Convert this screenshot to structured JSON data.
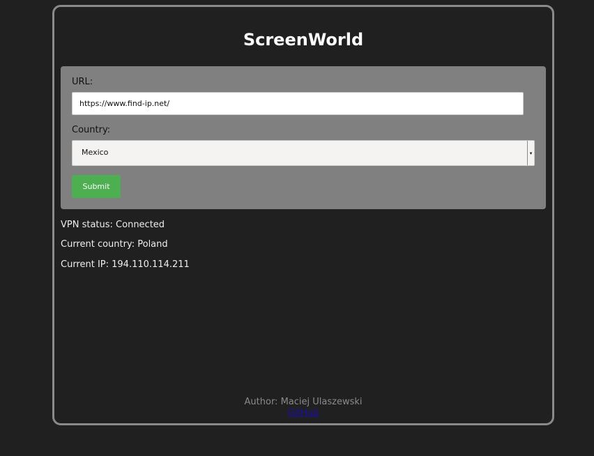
{
  "app": {
    "title": "ScreenWorld"
  },
  "form": {
    "url_label": "URL:",
    "url_value": "https://www.find-ip.net/",
    "country_label": "Country:",
    "country_selected": "Mexico",
    "submit_label": "Submit"
  },
  "status": {
    "vpn": "VPN status: Connected",
    "current_country": "Current country: Poland",
    "current_ip": "Current IP: 194.110.114.211"
  },
  "footer": {
    "author": "Author: Maciej Ulaszewski",
    "link_label": "GitHub"
  },
  "colors": {
    "background": "#202020",
    "panel": "#808080",
    "submit": "#4caf50",
    "frame_border": "#8a8a8a"
  },
  "icons": {
    "select_arrow": "chevron-down-icon"
  }
}
